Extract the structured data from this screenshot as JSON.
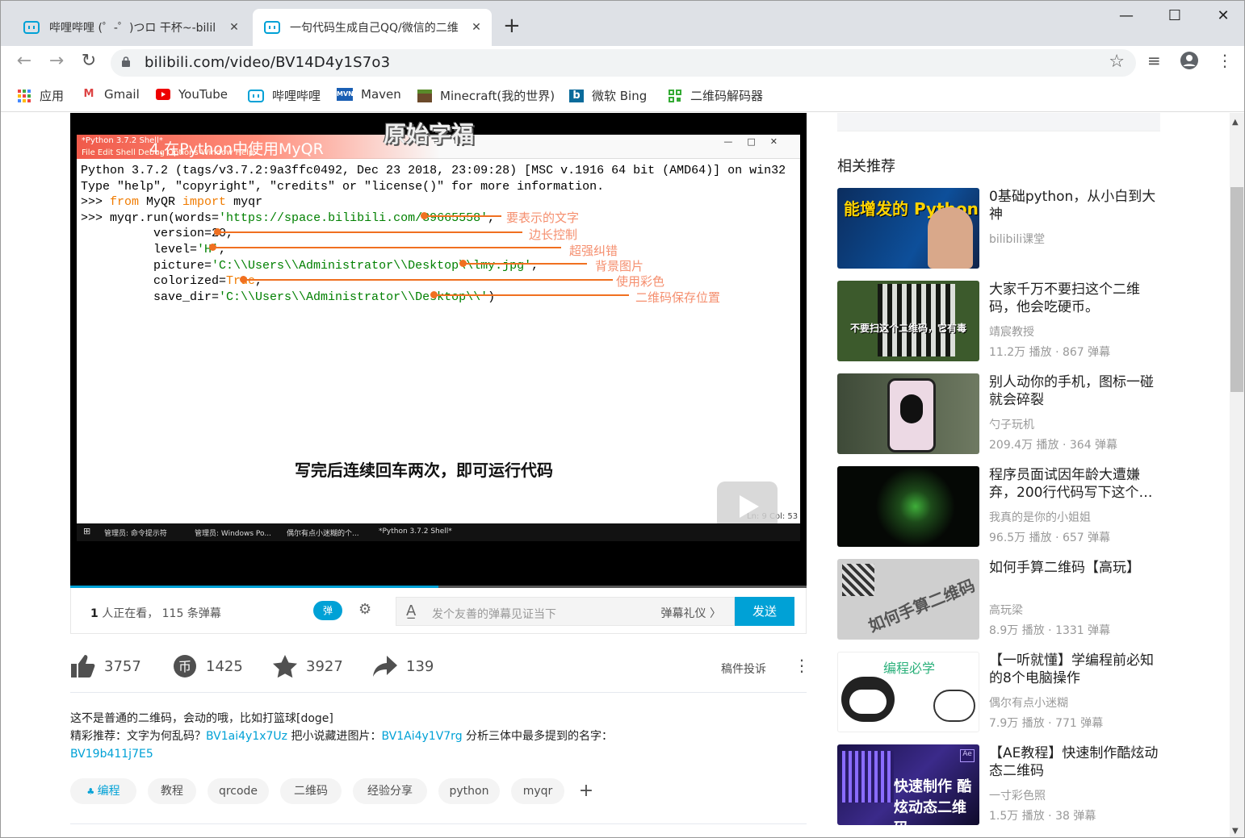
{
  "browser": {
    "tabs": [
      {
        "label": "哔哩哔哩 (゜-゜)つロ 干杯~-bilil"
      },
      {
        "label": "一句代码生成自己QQ/微信的二维"
      }
    ],
    "new_tab": "+",
    "url": "bilibili.com/video/BV14D4y1S7o3",
    "bookmarks": [
      {
        "label": "应用",
        "icon": "apps-icon"
      },
      {
        "label": "Gmail",
        "icon": "gmail-icon"
      },
      {
        "label": "YouTube",
        "icon": "youtube-icon"
      },
      {
        "label": "哔哩哔哩",
        "icon": "bilibili-icon"
      },
      {
        "label": "Maven",
        "icon": "maven-icon"
      },
      {
        "label": "Minecraft(我的世界)",
        "icon": "minecraft-icon"
      },
      {
        "label": "微软 Bing",
        "icon": "bing-icon"
      },
      {
        "label": "二维码解码器",
        "icon": "qr-icon"
      }
    ]
  },
  "video": {
    "chapter": "4.在Python中使用MyQR",
    "caption_top": "原始字福",
    "shell_title": "*Python 3.7.2 Shell*",
    "shell_menu": "File  Edit  Shell  Debug  Options  Window  Help",
    "code": {
      "l1": "Python 3.7.2 (tags/v3.7.2:9a3ffc0492, Dec 23 2018, 23:09:28) [MSC v.1916 64 bit (AMD64)] on win32",
      "l2": "Type \"help\", \"copyright\", \"credits\" or \"license()\" for more information.",
      "l3_prompt": ">>> ",
      "l3_from": "from",
      "l3_mid": " MyQR ",
      "l3_import": "import",
      "l3_end": " myqr",
      "l4_prompt": ">>> ",
      "l4_a": "myqr.run(words=",
      "l4_str": "'https://space.bilibili.com/39665558'",
      "l4_end": ",",
      "l5": "          version=20,",
      "l6_a": "          level=",
      "l6_str": "'H'",
      "l6_end": ",",
      "l7_a": "          picture=",
      "l7_str": "'C:\\\\Users\\\\Administrator\\\\Desktop\\\\lmy.jpg'",
      "l7_end": ",",
      "l8_a": "          colorized=",
      "l8_kw": "True",
      "l8_end": ",",
      "l9_a": "          save_dir=",
      "l9_str": "'C:\\\\Users\\\\Administrator\\\\Desktop\\\\'",
      "l9_end": ")"
    },
    "annotations": [
      "要表示的文字",
      "边长控制",
      "超强纠错",
      "背景图片",
      "使用彩色",
      "二维码保存位置"
    ],
    "subtitle": "写完后连续回车两次，即可运行代码",
    "status": "Ln: 9   Col: 53",
    "taskbar": [
      "管理员: 命令提示符",
      "管理员: Windows Po...",
      "偶尔有点小迷糊的个...",
      "*Python 3.7.2 Shell*"
    ],
    "progress": 0.5
  },
  "danmaku": {
    "viewers_count": "1",
    "viewers_text": " 人正在看，",
    "dm_count": " 115 条弹幕",
    "toggle_label": "弹",
    "placeholder": "发个友善的弹幕见证当下",
    "etiquette": "弹幕礼仪 〉",
    "send": "发送"
  },
  "actions": {
    "like": "3757",
    "coin": "1425",
    "fav": "3927",
    "share": "139",
    "report": "稿件投诉",
    "more": "⋮"
  },
  "description": {
    "line1": "这不是普通的二维码，会动的哦，比如打篮球[doge]",
    "line2_a": "精彩推荐：文字为何乱码？",
    "link1": "BV1ai4y1x7Uz",
    "line2_b": " 把小说藏进图片：",
    "link2": "BV1Ai4y1V7rg",
    "line2_c": " 分析三体中最多提到的名字：",
    "link3": "BV19b411j7E5"
  },
  "tags": [
    "编程",
    "教程",
    "qrcode",
    "二维码",
    "经验分享",
    "python",
    "myqr"
  ],
  "tag_add": "+",
  "related": {
    "title": "相关推荐",
    "items": [
      {
        "title": "0基础python，从小白到大神",
        "up": "bilibili课堂",
        "stats": "",
        "thumb_text": "能增发的 Python"
      },
      {
        "title": "大家千万不要扫这个二维码，他会吃硬币。",
        "up": "靖宸教授",
        "stats": "11.2万 播放 · 867 弹幕",
        "thumb_text": "不要扫这个二维码，它有毒"
      },
      {
        "title": "别人动你的手机，图标一碰就会碎裂",
        "up": "勺子玩机",
        "stats": "209.4万 播放 · 364 弹幕",
        "thumb_text": ""
      },
      {
        "title": "程序员面试因年龄大遭嫌弃，200行代码写下这个…",
        "up": "我真的是你的小姐姐",
        "stats": "96.5万 播放 · 657 弹幕",
        "thumb_text": ""
      },
      {
        "title": "如何手算二维码【高玩】",
        "up": "高玩梁",
        "stats": "8.9万 播放 · 1331 弹幕",
        "thumb_text": "如何手算二维码"
      },
      {
        "title": "【一听就懂】学编程前必知的8个电脑操作",
        "up": "偶尔有点小迷糊",
        "stats": "7.9万 播放 · 771 弹幕",
        "thumb_text": "编程必学"
      },
      {
        "title": "【AE教程】快速制作酷炫动态二维码",
        "up": "一寸彩色照",
        "stats": "1.5万 播放 · 38 弹幕",
        "thumb_text": "快速制作 酷炫动态二维码"
      }
    ]
  }
}
